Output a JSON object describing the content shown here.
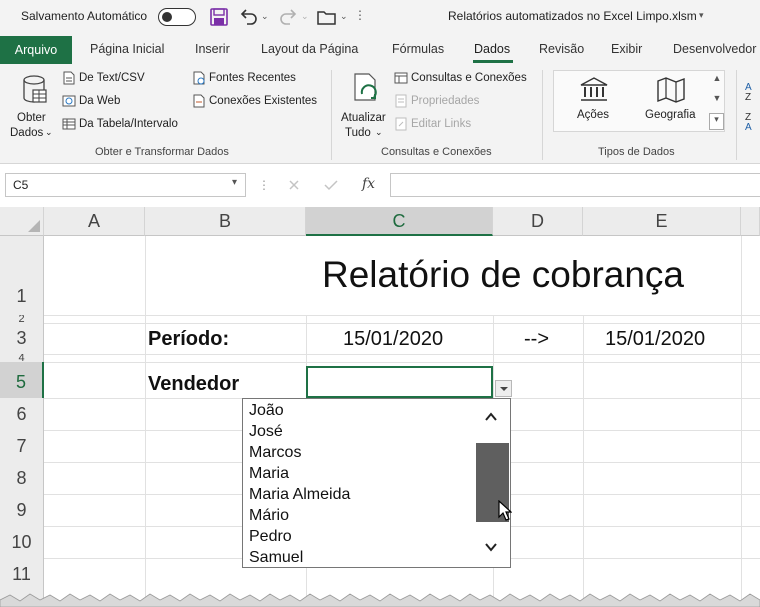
{
  "titlebar": {
    "autosave_label": "Salvamento Automático",
    "file_name": "Relatórios automatizados no Excel Limpo.xlsm"
  },
  "tabs": [
    {
      "label": "Arquivo"
    },
    {
      "label": "Página Inicial"
    },
    {
      "label": "Inserir"
    },
    {
      "label": "Layout da Página"
    },
    {
      "label": "Fórmulas"
    },
    {
      "label": "Dados"
    },
    {
      "label": "Revisão"
    },
    {
      "label": "Exibir"
    },
    {
      "label": "Desenvolvedor"
    }
  ],
  "active_tab": "Dados",
  "ribbon": {
    "get_data_line1": "Obter",
    "get_data_line2": "Dados",
    "from_text_csv": "De Text/CSV",
    "from_web": "Da Web",
    "from_table": "Da Tabela/Intervalo",
    "recent_sources": "Fontes Recentes",
    "existing_connections": "Conexões Existentes",
    "group_get_transform": "Obter e Transformar Dados",
    "refresh_line1": "Atualizar",
    "refresh_line2": "Tudo",
    "queries_connections": "Consultas e Conexões",
    "properties": "Propriedades",
    "edit_links": "Editar Links",
    "group_queries": "Consultas e Conexões",
    "stocks": "Ações",
    "geography": "Geografia",
    "group_data_types": "Tipos de Dados"
  },
  "formula_bar": {
    "name_box": "C5",
    "fx_label": "fx"
  },
  "columns": [
    "A",
    "B",
    "C",
    "D",
    "E"
  ],
  "rows": [
    "1",
    "2",
    "3",
    "4",
    "5",
    "6",
    "7",
    "8",
    "9",
    "10",
    "11"
  ],
  "sheet": {
    "title": "Relatório de cobrança",
    "period_label": "Período:",
    "period_start": "15/01/2020",
    "arrow": "-->",
    "period_end": "15/01/2020",
    "seller_label": "Vendedor"
  },
  "dropdown": {
    "items": [
      "João",
      "José",
      "Marcos",
      "Maria",
      "Maria Almeida",
      "Mário",
      "Pedro",
      "Samuel"
    ]
  },
  "colors": {
    "excel_green": "#1e7145",
    "ribbon_bg": "#f3f3f3",
    "header_bg": "#ececec"
  }
}
